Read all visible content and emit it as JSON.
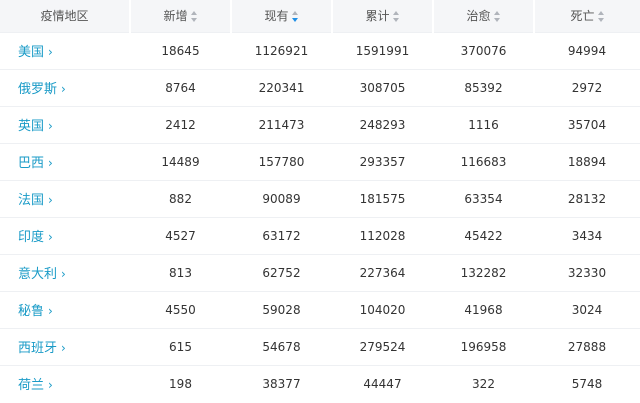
{
  "table": {
    "headers": [
      "疫情地区",
      "新增",
      "现有",
      "累计",
      "治愈",
      "死亡"
    ],
    "rows": [
      {
        "region": "美国",
        "new": "18645",
        "current": "1126921",
        "total": "1591991",
        "recovered": "370076",
        "deaths": "94994"
      },
      {
        "region": "俄罗斯",
        "new": "8764",
        "current": "220341",
        "total": "308705",
        "recovered": "85392",
        "deaths": "2972"
      },
      {
        "region": "英国",
        "new": "2412",
        "current": "211473",
        "total": "248293",
        "recovered": "1116",
        "deaths": "35704"
      },
      {
        "region": "巴西",
        "new": "14489",
        "current": "157780",
        "total": "293357",
        "recovered": "116683",
        "deaths": "18894"
      },
      {
        "region": "法国",
        "new": "882",
        "current": "90089",
        "total": "181575",
        "recovered": "63354",
        "deaths": "28132"
      },
      {
        "region": "印度",
        "new": "4527",
        "current": "63172",
        "total": "112028",
        "recovered": "45422",
        "deaths": "3434"
      },
      {
        "region": "意大利",
        "new": "813",
        "current": "62752",
        "total": "227364",
        "recovered": "132282",
        "deaths": "32330"
      },
      {
        "region": "秘鲁",
        "new": "4550",
        "current": "59028",
        "total": "104020",
        "recovered": "41968",
        "deaths": "3024"
      },
      {
        "region": "西班牙",
        "new": "615",
        "current": "54678",
        "total": "279524",
        "recovered": "196958",
        "deaths": "27888"
      },
      {
        "region": "荷兰",
        "new": "198",
        "current": "38377",
        "total": "44447",
        "recovered": "322",
        "deaths": "5748"
      }
    ],
    "sorted_column": "现有",
    "sort_direction": "desc"
  },
  "icons": {
    "sort": "sort-arrows-icon",
    "row_link": "chevron-right-icon"
  },
  "colors": {
    "region_link": "#1a9bc7",
    "active_sort": "#1f8fe6",
    "header_bg": "#f5f6f8"
  }
}
